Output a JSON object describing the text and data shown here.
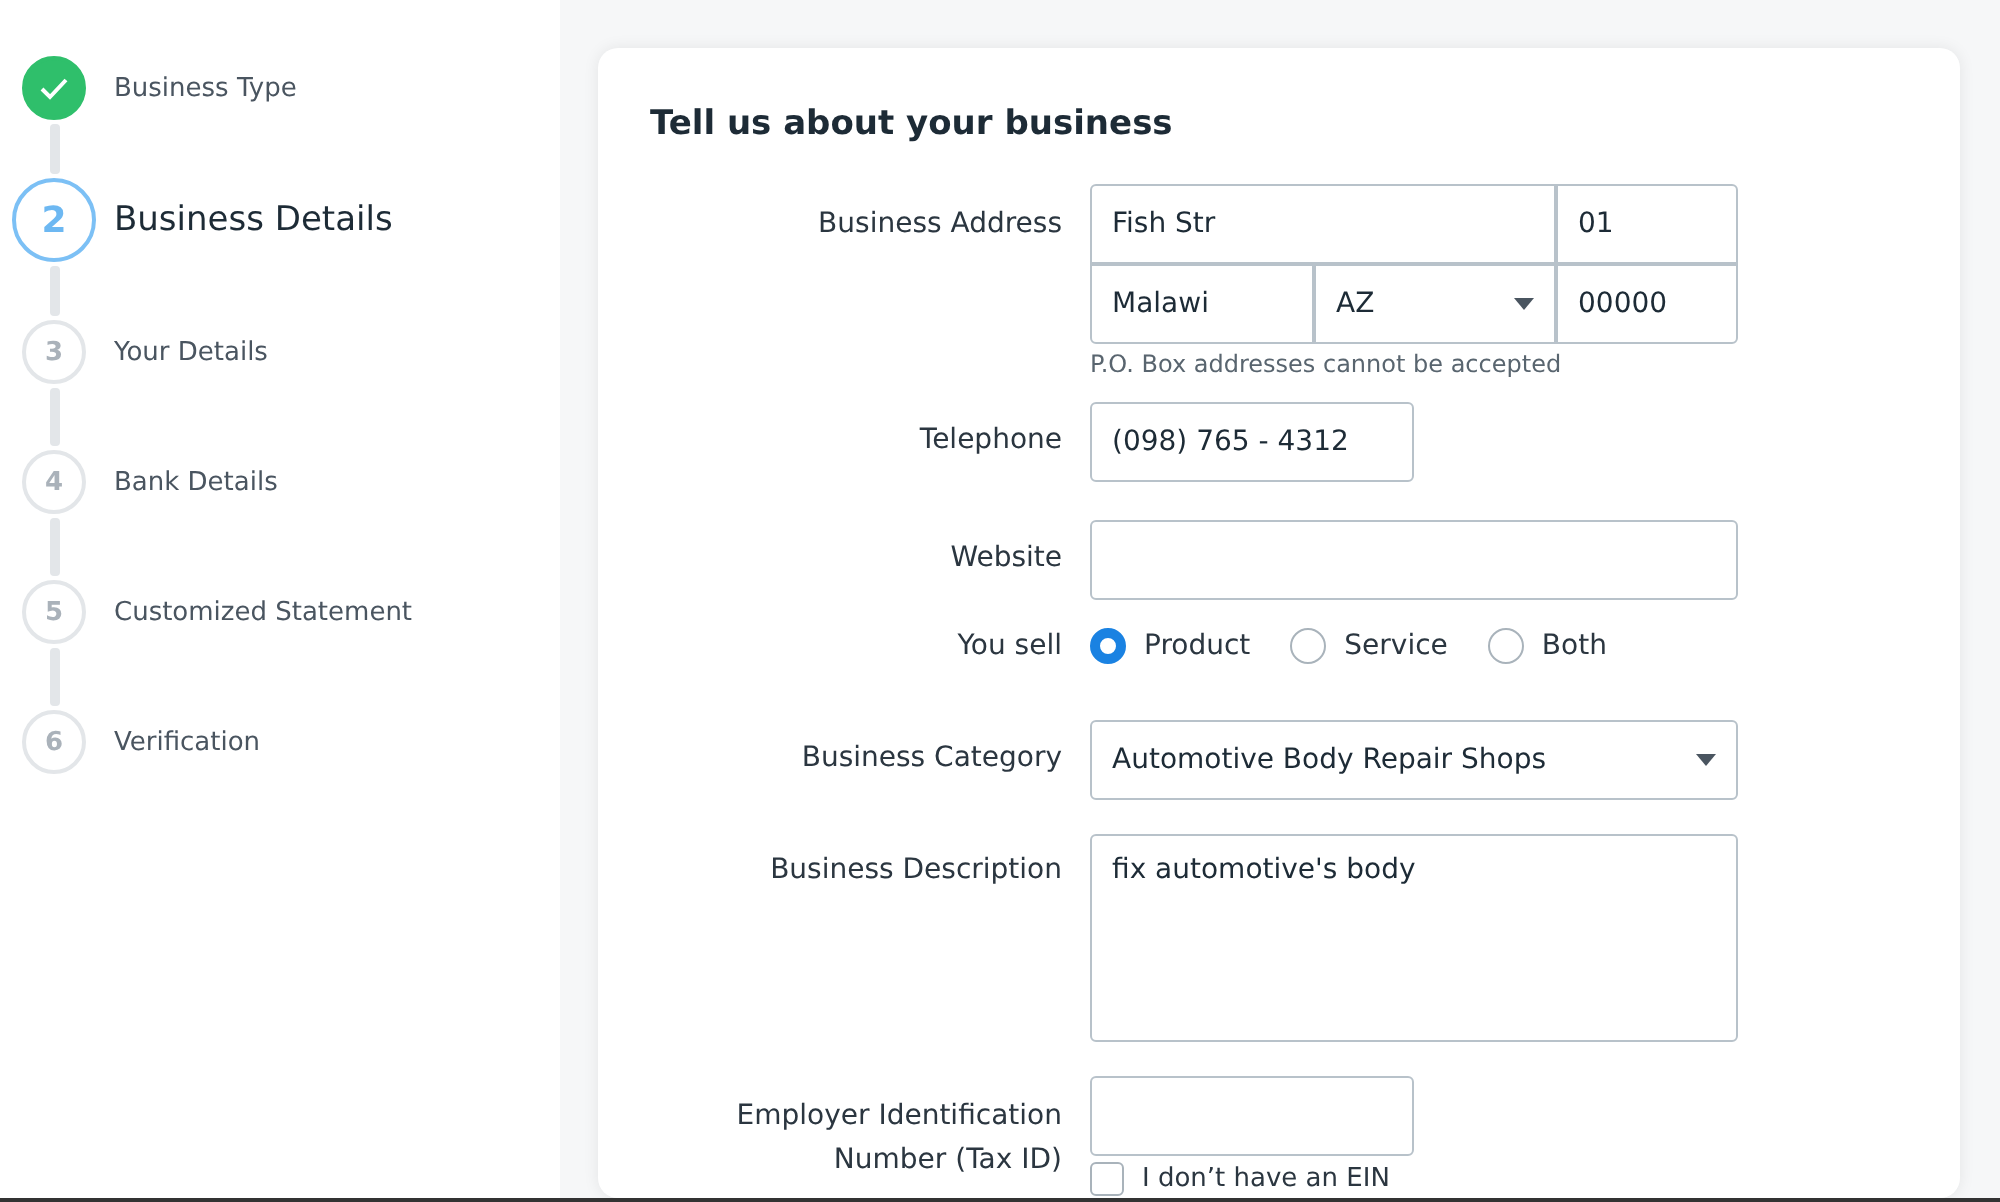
{
  "steps": [
    {
      "label": "Business Type",
      "done": true,
      "selected": false
    },
    {
      "number": "2",
      "label": "Business Details",
      "done": false,
      "selected": true
    },
    {
      "number": "3",
      "label": "Your Details",
      "done": false,
      "selected": false
    },
    {
      "number": "4",
      "label": "Bank Details",
      "done": false,
      "selected": false
    },
    {
      "number": "5",
      "label": "Customized Statement",
      "done": false,
      "selected": false
    },
    {
      "number": "6",
      "label": "Verification",
      "done": false,
      "selected": false
    }
  ],
  "form": {
    "title": "Tell us about your business",
    "address": {
      "label": "Business Address",
      "street": "Fish Str",
      "number": "01",
      "city": "Malawi",
      "state": "AZ",
      "zip": "00000",
      "note": "P.O. Box addresses cannot be accepted"
    },
    "telephone": {
      "label": "Telephone",
      "value": "(098) 765 - 4312"
    },
    "website": {
      "label": "Website"
    },
    "you_sell": {
      "label": "You sell",
      "options": [
        {
          "label": "Product",
          "selected": true
        },
        {
          "label": "Service",
          "selected": false
        },
        {
          "label": "Both",
          "selected": false
        }
      ]
    },
    "category": {
      "label": "Business Category",
      "value": "Automotive Body Repair Shops"
    },
    "description": {
      "label": "Business Description",
      "value": "fix automotive's body"
    },
    "ein": {
      "label": "Employer Identification Number (Tax ID)",
      "no_ein": {
        "label": "I don’t have an EIN",
        "checked": false
      }
    }
  }
}
